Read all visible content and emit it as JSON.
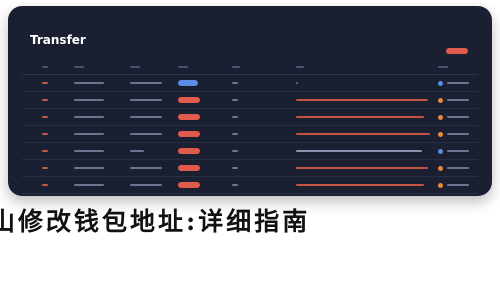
{
  "window": {
    "title": "Transfer"
  },
  "caption": "山修改钱包地址:详细指南",
  "colors": {
    "panel": "#1a2032",
    "accent_red": "#e15b4c",
    "accent_blue": "#5b8de6",
    "status_orange": "#e8883a"
  },
  "rows": [
    {
      "amount_badge": "blue-pill",
      "status_dot": "blue"
    },
    {
      "amount_badge": "red-pill",
      "status_dot": "orange"
    },
    {
      "amount_badge": "red-pill",
      "status_dot": "orange"
    },
    {
      "amount_badge": "red-pill",
      "status_dot": "orange"
    },
    {
      "amount_badge": "red-pill",
      "status_dot": "blue"
    },
    {
      "amount_badge": "red-pill",
      "status_dot": "orange"
    },
    {
      "amount_badge": "red-pill",
      "status_dot": "orange"
    }
  ]
}
